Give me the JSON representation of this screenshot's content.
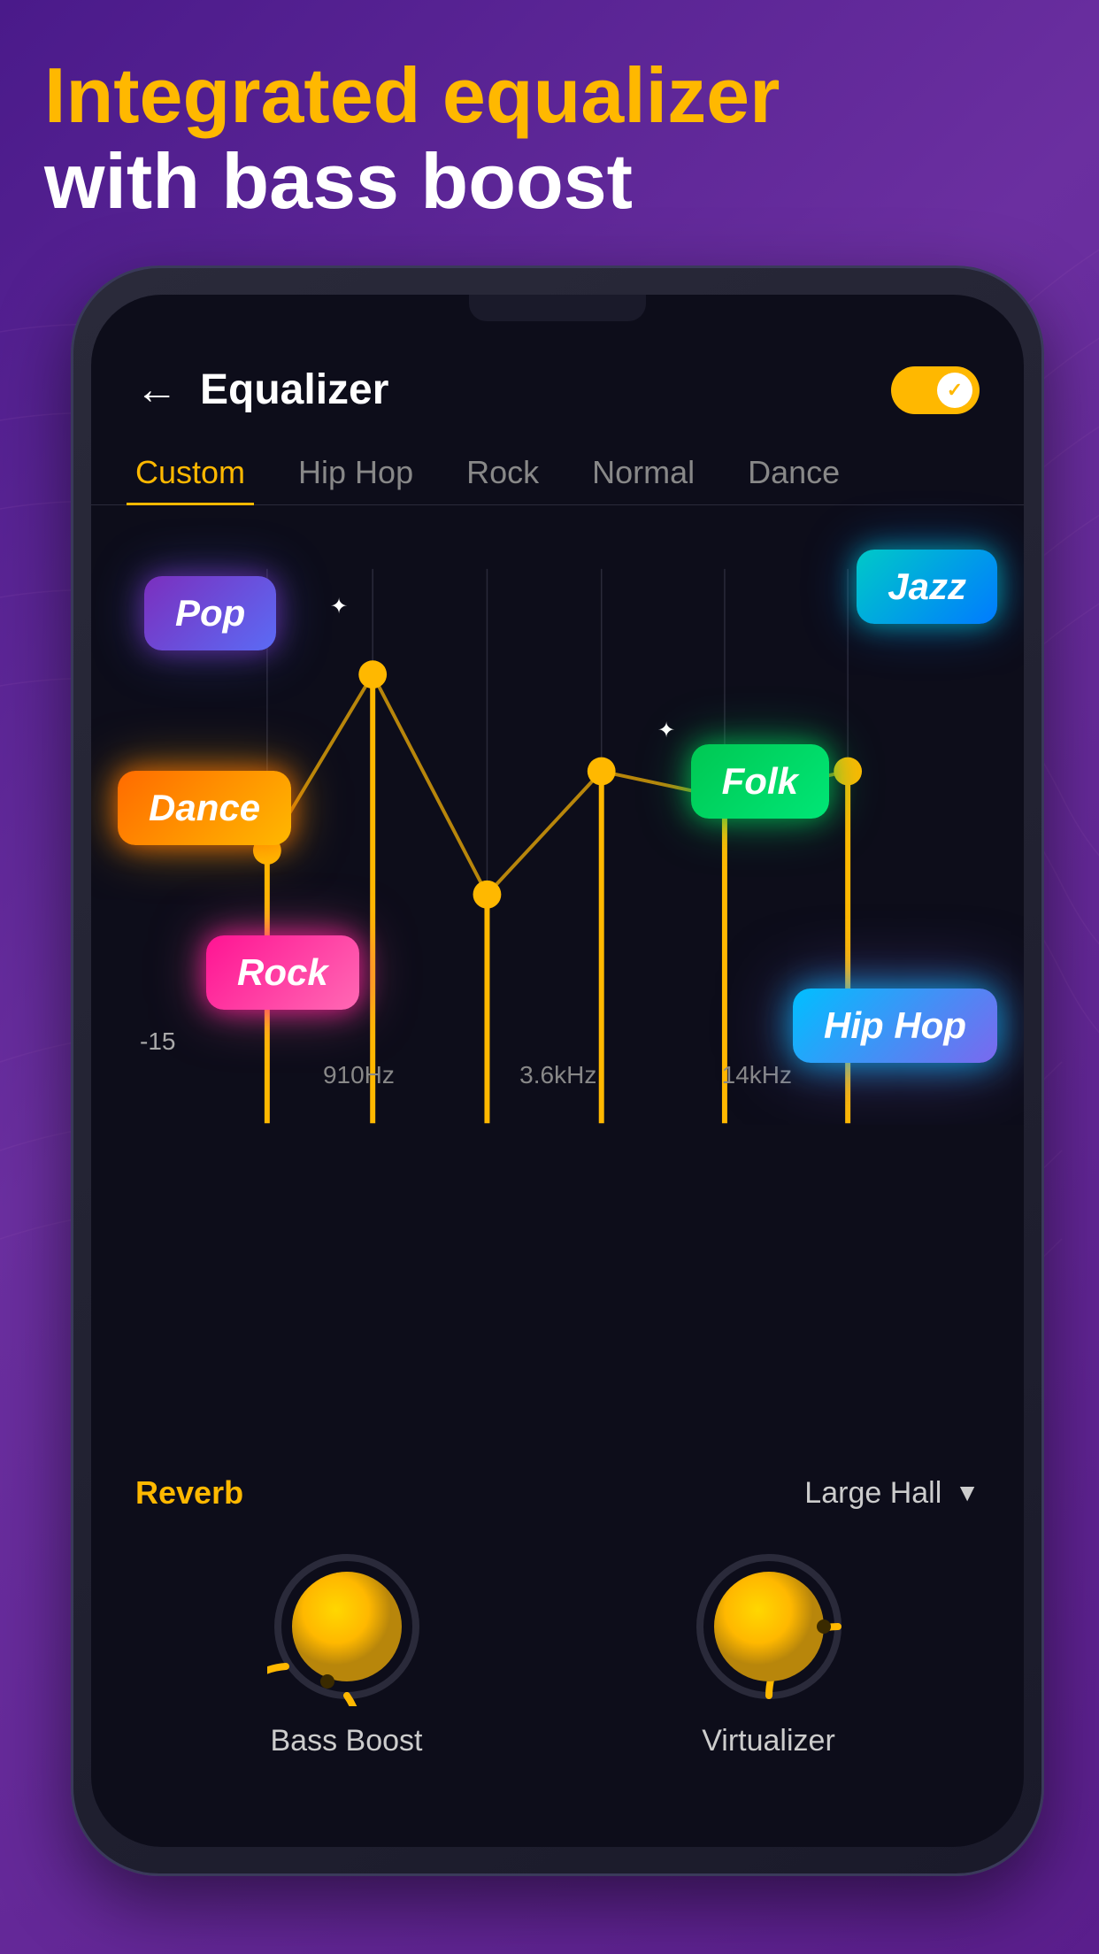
{
  "page": {
    "background": "#5a1e8c",
    "headerLine1": "Integrated equalizer",
    "headerLine2": "with bass boost"
  },
  "app": {
    "title": "Equalizer",
    "backLabel": "←",
    "toggleEnabled": true,
    "toggleCheck": "✓"
  },
  "tabs": [
    {
      "label": "Custom",
      "active": true
    },
    {
      "label": "Hip Hop",
      "active": false
    },
    {
      "label": "Rock",
      "active": false
    },
    {
      "label": "Normal",
      "active": false
    },
    {
      "label": "Dance",
      "active": false
    }
  ],
  "eq": {
    "dbLabel": "-15",
    "frequencies": [
      "",
      "910Hz",
      "3.6kHz",
      "14kHz",
      ""
    ]
  },
  "badges": [
    {
      "label": "Pop",
      "class": "badge-pop"
    },
    {
      "label": "Jazz",
      "class": "badge-jazz"
    },
    {
      "label": "Dance",
      "class": "badge-dance"
    },
    {
      "label": "Folk",
      "class": "badge-folk"
    },
    {
      "label": "Rock",
      "class": "badge-rock"
    },
    {
      "label": "Hip Hop",
      "class": "badge-hiphop"
    }
  ],
  "reverb": {
    "label": "Reverb",
    "value": "Large Hall"
  },
  "knobs": [
    {
      "label": "Bass Boost"
    },
    {
      "label": "Virtualizer"
    }
  ],
  "colors": {
    "accent": "#FFB800",
    "bg": "#0d0d1a",
    "purple": "#6b2fa0"
  }
}
